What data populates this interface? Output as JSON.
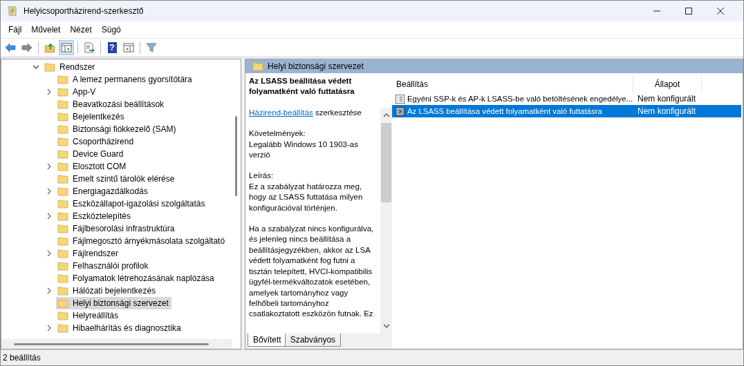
{
  "window": {
    "title": "Helyicsoportházirend-szerkesztő"
  },
  "menu": [
    "Fájl",
    "Művelet",
    "Nézet",
    "Súgó"
  ],
  "toolbar": [
    [
      {
        "kind": "back",
        "pressed": false
      },
      {
        "kind": "forward",
        "pressed": false
      }
    ],
    [
      {
        "kind": "up",
        "pressed": false
      },
      {
        "kind": "tree",
        "pressed": true
      }
    ],
    [
      {
        "kind": "export",
        "pressed": false
      }
    ],
    [
      {
        "kind": "help",
        "glyph": "?",
        "pressed": false
      },
      {
        "kind": "pane",
        "pressed": false
      }
    ],
    [
      {
        "kind": "filter",
        "pressed": false
      }
    ]
  ],
  "tree": [
    {
      "label": "Rendszer",
      "expanded": true,
      "expandable": true,
      "selected": false,
      "children": [
        {
          "label": "A lemez permanens gyorsítótára",
          "expandable": false,
          "selected": false
        },
        {
          "label": "App-V",
          "expandable": true,
          "selected": false
        },
        {
          "label": "Beavatkozási beállítások",
          "expandable": false,
          "selected": false
        },
        {
          "label": "Bejelentkezés",
          "expandable": false,
          "selected": false
        },
        {
          "label": "Biztonsági fiókkezelő (SAM)",
          "expandable": false,
          "selected": false
        },
        {
          "label": "Csoportházirend",
          "expandable": false,
          "selected": false
        },
        {
          "label": "Device Guard",
          "expandable": false,
          "selected": false
        },
        {
          "label": "Elosztott COM",
          "expandable": true,
          "selected": false
        },
        {
          "label": "Emelt szintű tárolók elérése",
          "expandable": false,
          "selected": false
        },
        {
          "label": "Energiagazdálkodás",
          "expandable": true,
          "selected": false
        },
        {
          "label": "Eszközállapot-igazolási szolgáltatás",
          "expandable": false,
          "selected": false
        },
        {
          "label": "Eszköztelepítés",
          "expandable": true,
          "selected": false
        },
        {
          "label": "Fájlbesorolási infrastruktúra",
          "expandable": false,
          "selected": false
        },
        {
          "label": "Fájlmegosztó árnyékmásolata szolgáltató",
          "expandable": false,
          "selected": false
        },
        {
          "label": "Fájlrendszer",
          "expandable": true,
          "selected": false
        },
        {
          "label": "Felhasználói profilok",
          "expandable": false,
          "selected": false
        },
        {
          "label": "Folyamatok létrehozásának naplózása",
          "expandable": false,
          "selected": false
        },
        {
          "label": "Hálózati bejelentkezés",
          "expandable": true,
          "selected": false
        },
        {
          "label": "Helyi biztonsági szervezet",
          "expandable": false,
          "selected": true
        },
        {
          "label": "Helyreállítás",
          "expandable": false,
          "selected": false
        },
        {
          "label": "Hibaelhárítás és diagnosztika",
          "expandable": true,
          "selected": false
        }
      ]
    }
  ],
  "panel_header": {
    "title": "Helyi biztonsági szervezet"
  },
  "description": {
    "title": "Az LSASS beállítása védett folyamatként való futtatásra",
    "link": "Házirend-beállítás",
    "link_suffix": "szerkesztése",
    "paragraphs": [
      {
        "heading": "Követelmények:",
        "text": "Legalább Windows 10 1903-as verzió"
      },
      {
        "heading": "Leírás:",
        "text": "Ez a szabályzat határozza meg, hogy az LSASS futtatása milyen konfigurációval történjen."
      },
      {
        "text": "Ha a szabályzat nincs konfigurálva, és jelenleg nincs beállítása a beállításjegyzékben, akkor az LSA védett folyamatként fog futni a tisztán telepített, HVCI-kompatibilis ügyfél-termékváltozatok esetében, amelyek tartományhoz vagy felhőbeli tartományhoz csatlakoztatott eszközön futnak. Ez"
      }
    ]
  },
  "view_tabs": [
    {
      "label": "Bővített",
      "selected": true
    },
    {
      "label": "Szabványos",
      "selected": false
    }
  ],
  "table": {
    "columns": [
      "Beállítás",
      "Állapot"
    ],
    "rows": [
      {
        "kind": "setting",
        "name": "Egyéni SSP-k és AP-k LSASS-be való betöltésének engedélye...",
        "state": "Nem konfigurált",
        "selected": false
      },
      {
        "kind": "setting-selected",
        "name": "Az LSASS beállítása védett folyamatként való futtatásra",
        "state": "Nem konfigurált",
        "selected": true
      }
    ]
  },
  "status_bar": "2 beállítás"
}
